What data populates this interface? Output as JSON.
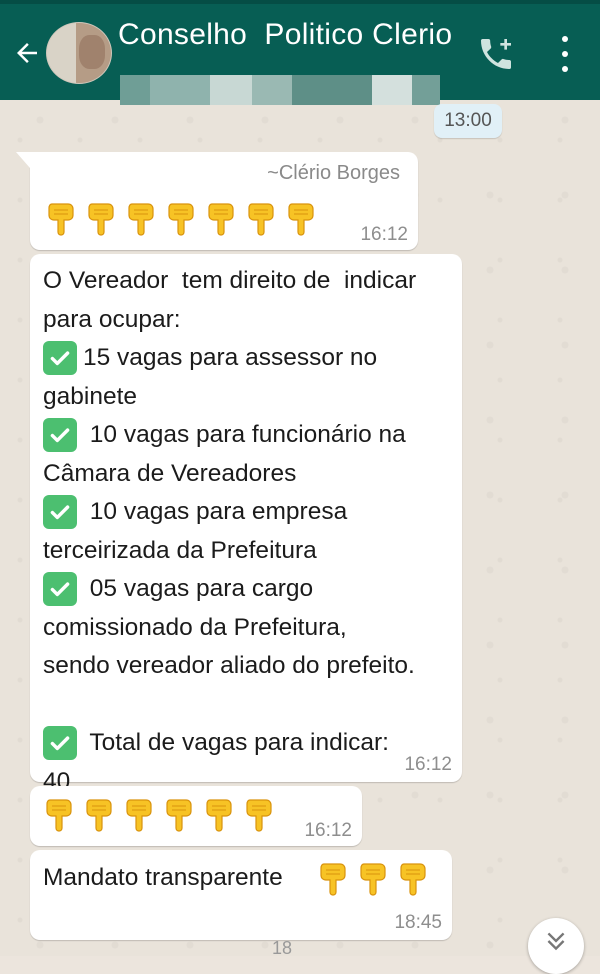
{
  "header": {
    "title": "Conselho  Politico Clerio",
    "back_icon": "arrow-left-icon",
    "call_icon": "add-call-icon",
    "menu_icon": "more-vert-icon",
    "colors": {
      "bar": "#075e54",
      "text": "#ffffff"
    }
  },
  "date_chip": "13:00",
  "messages": [
    {
      "sender": "~Clério Borges",
      "emoji": "point-down-hand",
      "emoji_count": 7,
      "time": "16:12"
    },
    {
      "lines": [
        {
          "check": false,
          "text": "O Vereador  tem direito de  indicar"
        },
        {
          "check": false,
          "text": "para ocupar:"
        },
        {
          "check": true,
          "text": "15 vagas para assessor no"
        },
        {
          "check": false,
          "text": "gabinete"
        },
        {
          "check": true,
          "text": " 10 vagas para funcionário na"
        },
        {
          "check": false,
          "text": "Câmara de Vereadores"
        },
        {
          "check": true,
          "text": " 10 vagas para empresa"
        },
        {
          "check": false,
          "text": "terceirizada da Prefeitura"
        },
        {
          "check": true,
          "text": " 05 vagas para cargo"
        },
        {
          "check": false,
          "text": "comissionado da Prefeitura,"
        },
        {
          "check": false,
          "text": "sendo vereador aliado do prefeito."
        },
        {
          "check": false,
          "text": " "
        },
        {
          "check": true,
          "text": " Total de vagas para indicar:"
        },
        {
          "check": false,
          "text": "40"
        }
      ],
      "time": "16:12",
      "check_icon": "check-box-icon",
      "check_color": "#4cbf70"
    },
    {
      "emoji": "point-down-hand",
      "emoji_count": 6,
      "time": "16:12"
    },
    {
      "text": "Mandato transparente",
      "emoji": "point-down-hand",
      "emoji_count": 3,
      "time": "18:45"
    }
  ],
  "partial_time": "18",
  "scroll_down_icon": "double-chevron-down-icon"
}
